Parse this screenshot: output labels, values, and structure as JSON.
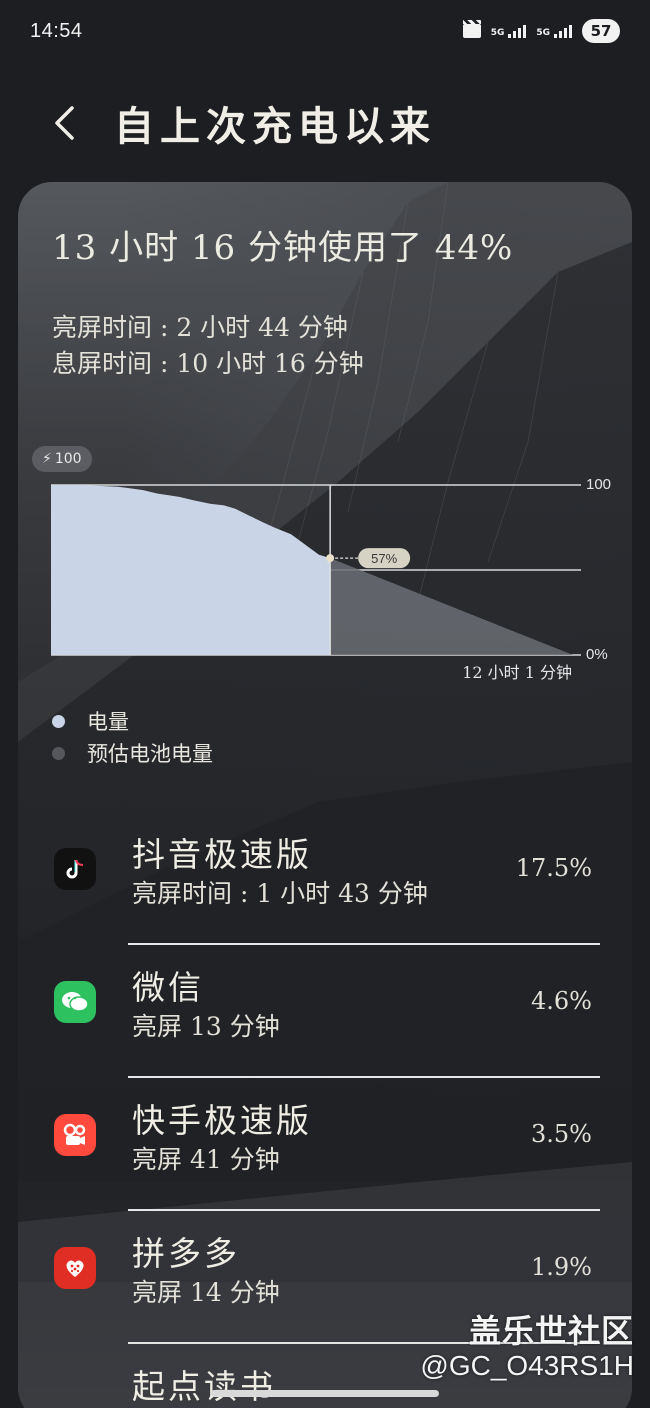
{
  "status_bar": {
    "time": "14:54",
    "network_1": "5G",
    "network_2": "5G",
    "battery": "57"
  },
  "header": {
    "title": "自上次充电以来"
  },
  "summary": {
    "usage": "13 小时 16 分钟使用了 44%",
    "screen_on": "亮屏时间 : 2 小时 44 分钟",
    "screen_off": "息屏时间 : 10 小时 16 分钟"
  },
  "chart": {
    "charge_badge": "100",
    "y_top_label": "100",
    "y_bottom_label": "0%",
    "current_label": "57%",
    "remaining_label": "12 小时 1 分钟"
  },
  "chart_data": {
    "type": "area",
    "ylim": [
      0,
      100
    ],
    "y_tick_labels": [
      "100",
      "0%"
    ],
    "series": [
      {
        "name": "电量",
        "x": [
          0,
          0.1,
          0.24,
          0.33,
          0.38,
          0.46,
          0.51,
          0.57,
          0.62,
          0.66,
          0.71,
          0.76,
          0.8,
          0.86,
          0.91,
          0.96,
          1.0
        ],
        "values": [
          100,
          100,
          99,
          97,
          95,
          93,
          91,
          89,
          88,
          86,
          82,
          78,
          75,
          71,
          65,
          59,
          57
        ]
      },
      {
        "name": "预估电池电量",
        "x": [
          1.0,
          1.87
        ],
        "values": [
          57,
          0
        ]
      }
    ],
    "grid": true
  },
  "legend": [
    {
      "label": "电量",
      "color": "#c9d4e6"
    },
    {
      "label": "预估电池电量",
      "color": "#55575c"
    }
  ],
  "apps": [
    {
      "name": "抖音极速版",
      "detail": "亮屏时间 : 1 小时 43 分钟",
      "percent": "17.5%",
      "icon": "douyin-icon"
    },
    {
      "name": "微信",
      "detail": "亮屏 13 分钟",
      "percent": "4.6%",
      "icon": "wechat-icon"
    },
    {
      "name": "快手极速版",
      "detail": "亮屏 41 分钟",
      "percent": "3.5%",
      "icon": "kuaishou-icon"
    },
    {
      "name": "拼多多",
      "detail": "亮屏 14 分钟",
      "percent": "1.9%",
      "icon": "pinduoduo-icon"
    },
    {
      "name": "起点读书",
      "detail": "",
      "percent": "",
      "icon": "qidian-icon"
    }
  ],
  "watermark": {
    "line1": "盖乐世社区",
    "line2": "@GC_O43RS1H"
  }
}
